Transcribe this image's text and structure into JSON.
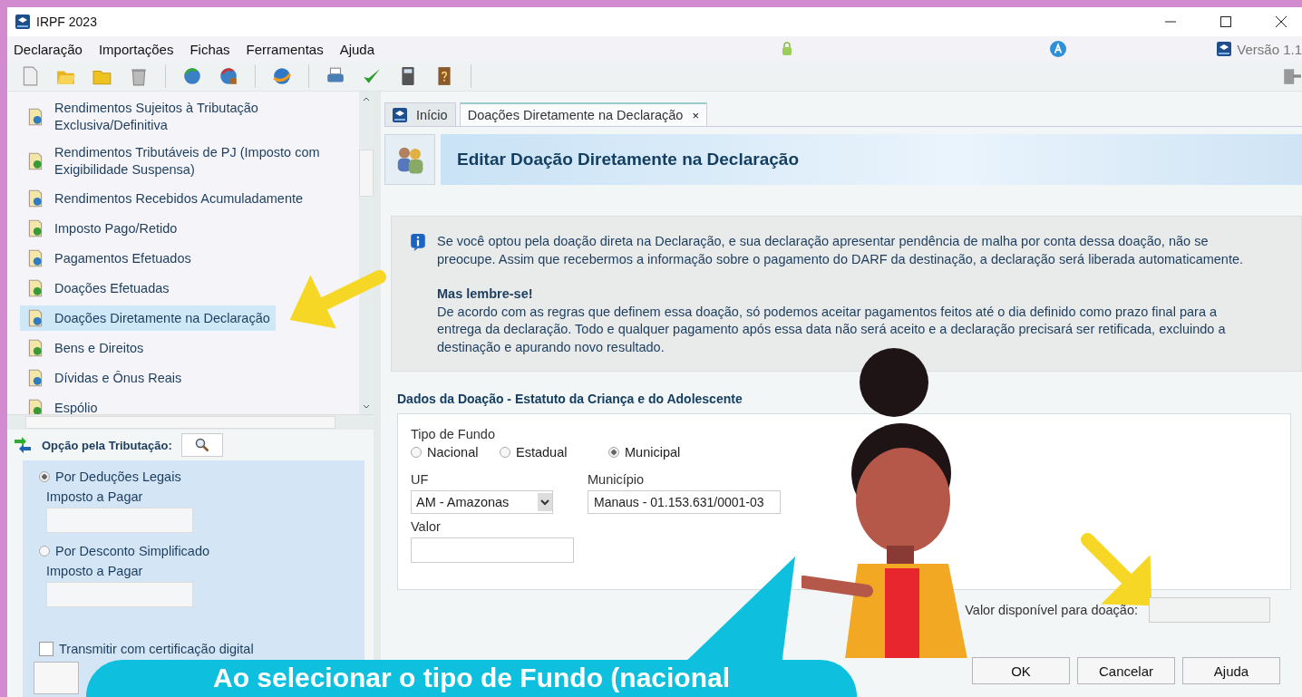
{
  "window": {
    "title": "IRPF 2023"
  },
  "menu": [
    {
      "label": "Declaração"
    },
    {
      "label": "Importações"
    },
    {
      "label": "Fichas"
    },
    {
      "label": "Ferramentas"
    },
    {
      "label": "Ajuda"
    }
  ],
  "version": "Versão 1.1",
  "sidebar": {
    "items": [
      {
        "label": "Rendimentos Sujeitos à Tributação Exclusiva/Definitiva",
        "selected": false
      },
      {
        "label": "Rendimentos Tributáveis de PJ (Imposto com Exigibilidade Suspensa)",
        "selected": false
      },
      {
        "label": "Rendimentos Recebidos Acumuladamente",
        "selected": false
      },
      {
        "label": "Imposto Pago/Retido",
        "selected": false
      },
      {
        "label": "Pagamentos Efetuados",
        "selected": false
      },
      {
        "label": "Doações Efetuadas",
        "selected": false
      },
      {
        "label": "Doações Diretamente na Declaração",
        "selected": true
      },
      {
        "label": "Bens e Direitos",
        "selected": false
      },
      {
        "label": "Dívidas e Ônus Reais",
        "selected": false
      },
      {
        "label": "Espólio",
        "selected": false
      }
    ]
  },
  "tributacao": {
    "label": "Opção pela Tributação:",
    "options": [
      {
        "label": "Por Deduções Legais",
        "selected": true,
        "field_label": "Imposto a Pagar"
      },
      {
        "label": "Por Desconto Simplificado",
        "selected": false,
        "field_label": "Imposto a Pagar"
      }
    ],
    "certificate": {
      "label": "Transmitir com certificação digital",
      "checked": false
    }
  },
  "tabs": [
    {
      "label": "Início",
      "selected": false
    },
    {
      "label": "Doações Diretamente na Declaração",
      "selected": true,
      "close": "×"
    }
  ],
  "panel": {
    "title": "Editar Doação Diretamente na Declaração",
    "info": {
      "paragraph1": "Se você optou pela doação direta na Declaração, e sua declaração apresentar pendência de malha por conta dessa doação, não se preocupe. Assim que recebermos a informação sobre o pagamento do DARF da destinação, a declaração será liberada automaticamente.",
      "heading": "Mas lembre-se!",
      "paragraph2": "De acordo com as regras que definem essa doação, só podemos aceitar pagamentos feitos até o dia definido como prazo final para a entrega da declaração. Todo e qualquer pagamento após essa data não será aceito e a declaração precisará ser retificada, excluindo a destinação e apurando novo resultado."
    }
  },
  "form": {
    "section_title": "Dados da Doação - Estatuto da Criança e do Adolescente",
    "fund_type": {
      "label": "Tipo de Fundo",
      "options": [
        {
          "label": "Nacional",
          "selected": false
        },
        {
          "label": "Estadual",
          "selected": false
        },
        {
          "label": "Municipal",
          "selected": true
        }
      ]
    },
    "uf": {
      "label": "UF",
      "value": "AM - Amazonas"
    },
    "municipio": {
      "label": "Município",
      "value": "Manaus - 01.153.631/0001-03"
    },
    "valor": {
      "label": "Valor"
    },
    "available": {
      "label": "Valor disponível para doação:"
    }
  },
  "buttons": [
    {
      "label": "OK"
    },
    {
      "label": "Cancelar"
    },
    {
      "label": "Ajuda"
    }
  ],
  "overlay": {
    "speech": "Ao selecionar o tipo de Fundo (nacional"
  }
}
